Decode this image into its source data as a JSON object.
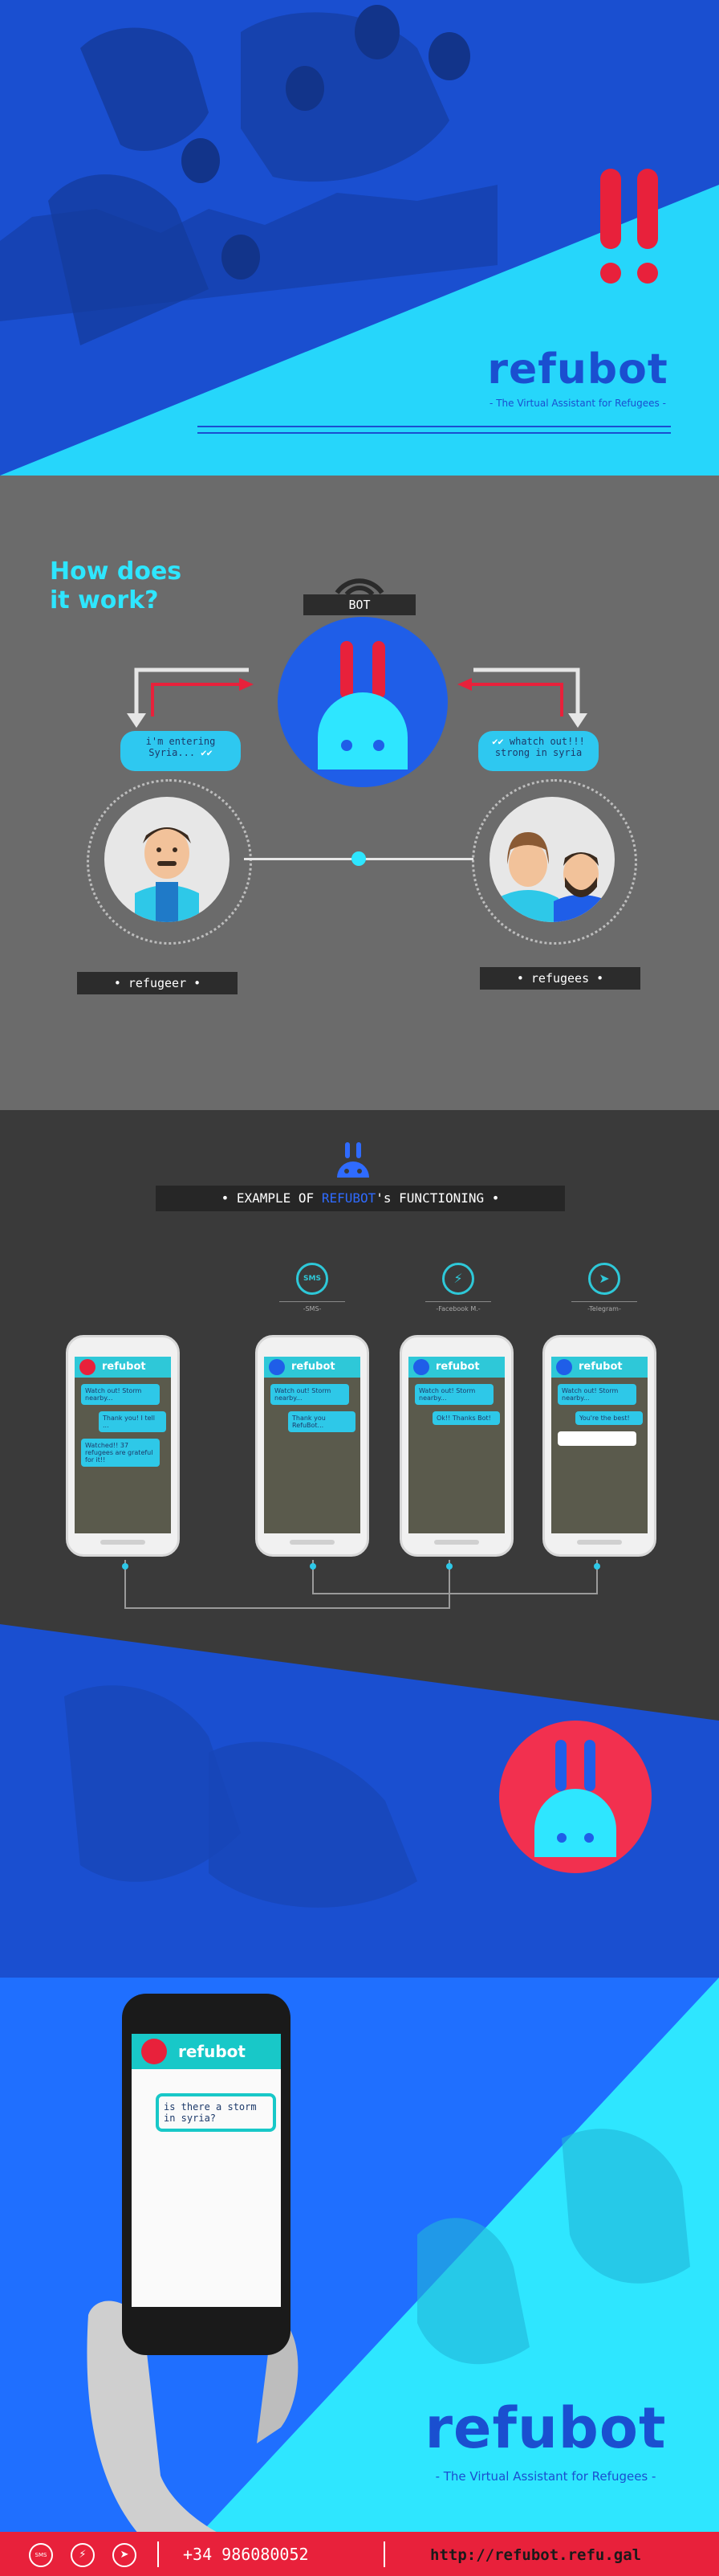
{
  "hero": {
    "logo": "refubot",
    "tagline": "- The Virtual Assistant for Refugees -",
    "alert_symbol": "!!"
  },
  "how": {
    "title_line1": "How does",
    "title_line2": "it work?",
    "bot_label": "BOT",
    "left_bubble": "i'm entering Syria...",
    "right_bubble": "whatch out!!! strong in syria",
    "left_label": "refugeer",
    "right_label": "refugees"
  },
  "example": {
    "ribbon_prefix": "EXAMPLE OF ",
    "ribbon_brand": "REFUBOT",
    "ribbon_suffix": "'s FUNCTIONING",
    "channels": [
      {
        "icon": "sms-icon",
        "label": "SMS",
        "caption": "-SMS-"
      },
      {
        "icon": "messenger-icon",
        "label": "",
        "caption": "-Facebook M.-"
      },
      {
        "icon": "telegram-icon",
        "label": "",
        "caption": "-Telegram-"
      }
    ],
    "phones": [
      {
        "app": "refubot",
        "msgs": [
          "Watch out! Storm nearby...",
          "Thank you! I tell ...",
          "Watched!! 37 refugees are grateful for it!!"
        ]
      },
      {
        "app": "refubot",
        "msgs": [
          "Watch out! Storm nearby...",
          "Thank you RefuBot..."
        ]
      },
      {
        "app": "refubot",
        "msgs": [
          "Watch out! Storm nearby...",
          "Ok!! Thanks Bot!"
        ]
      },
      {
        "app": "refubot",
        "msgs": [
          "Watch out! Storm nearby...",
          "You're the best!",
          ""
        ]
      }
    ]
  },
  "bottom": {
    "phone_app": "refubot",
    "phone_bubble": "is there a storm in syria?",
    "logo": "refubot",
    "tagline": "- The Virtual Assistant for Refugees -",
    "phone_number": "+34 986080052",
    "url": "http://refubot.refu.gal",
    "colors": {
      "accent": "#e8213b",
      "cyan": "#2ee6ff",
      "blue": "#1f6fff"
    }
  }
}
